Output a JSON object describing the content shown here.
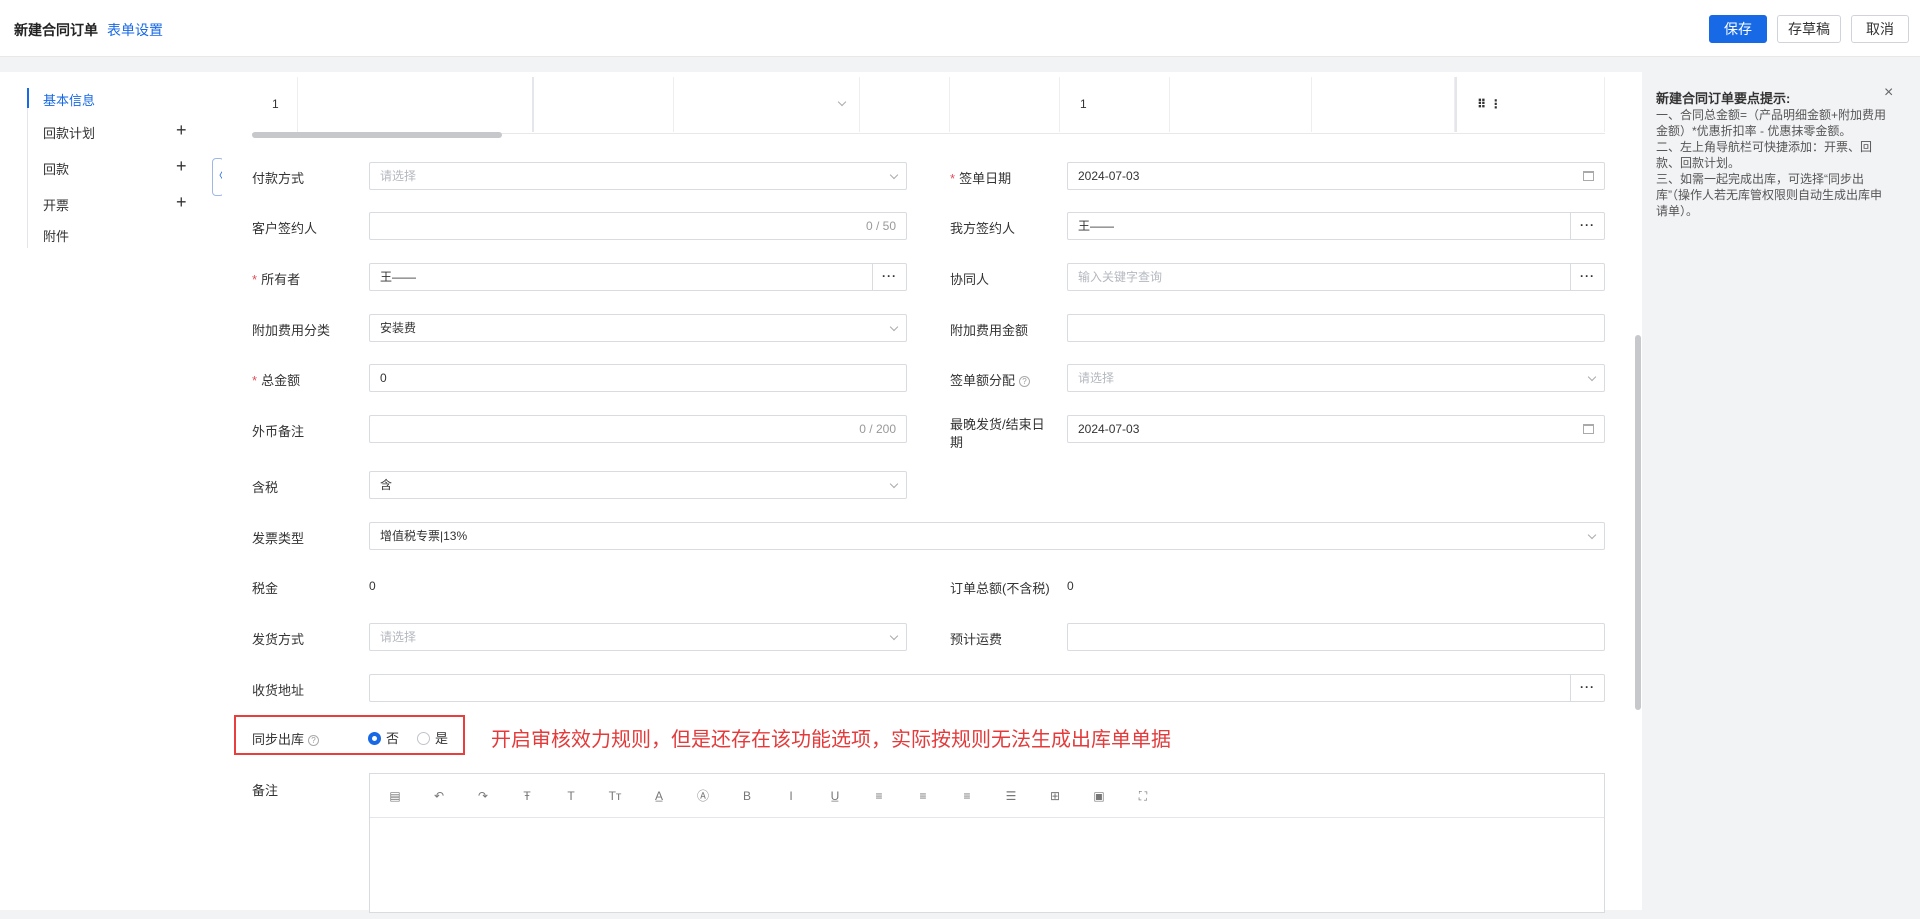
{
  "header": {
    "title": "新建合同订单",
    "settings_link": "表单设置",
    "save": "保存",
    "draft": "存草稿",
    "cancel": "取消"
  },
  "nav": {
    "items": [
      {
        "label": "基本信息"
      },
      {
        "label": "回款计划"
      },
      {
        "label": "回款"
      },
      {
        "label": "开票"
      },
      {
        "label": "附件"
      }
    ],
    "plus": "+",
    "collapse": "〈"
  },
  "table_row": {
    "index": "1",
    "qty": "1",
    "handle": "⠿ ⋮"
  },
  "form": {
    "payment_method": {
      "label": "付款方式",
      "placeholder": "请选择"
    },
    "sign_date": {
      "label": "签单日期",
      "value": "2024-07-03"
    },
    "customer_signer": {
      "label": "客户签约人",
      "count": "0 / 50"
    },
    "our_signer": {
      "label": "我方签约人",
      "value": "王——"
    },
    "owner": {
      "label": "所有者",
      "value": "王——"
    },
    "collaborator": {
      "label": "协同人",
      "placeholder": "输入关键字查询"
    },
    "extra_fee_type": {
      "label": "附加费用分类",
      "value": "安装费"
    },
    "extra_fee_amount": {
      "label": "附加费用金额",
      "value": ""
    },
    "total_amount": {
      "label": "总金额",
      "value": "0"
    },
    "sign_distribution": {
      "label": "签单额分配",
      "placeholder": "请选择"
    },
    "fx_note": {
      "label": "外币备注",
      "count": "0 / 200"
    },
    "latest_ship_date": {
      "label": "最晚发货/结束日期",
      "label_line1": "最晚发货/结束日",
      "label_line2": "期",
      "value": "2024-07-03"
    },
    "tax_included": {
      "label": "含税",
      "value": "含"
    },
    "invoice_type": {
      "label": "发票类型",
      "value": "增值税专票|13%"
    },
    "tax": {
      "label": "税金",
      "value": "0"
    },
    "order_total_ex_tax": {
      "label": "订单总额(不含税)",
      "value": "0"
    },
    "ship_method": {
      "label": "发货方式",
      "placeholder": "请选择"
    },
    "est_freight": {
      "label": "预计运费",
      "value": ""
    },
    "ship_address": {
      "label": "收货地址",
      "value": ""
    },
    "sync_outbound": {
      "label": "同步出库",
      "option_no": "否",
      "option_yes": "是",
      "selected": "否"
    },
    "remarks": {
      "label": "备注"
    }
  },
  "required_mark": "*",
  "more_glyph": "···",
  "help_glyph": "?",
  "annotation": "开启审核效力规则，但是还存在该功能选项，实际按规则无法生成出库单单据",
  "editor_toolbar": [
    {
      "icon": "format-painter-icon",
      "glyph": "▤"
    },
    {
      "icon": "undo-icon",
      "glyph": "↶"
    },
    {
      "icon": "redo-icon",
      "glyph": "↷"
    },
    {
      "icon": "strikethrough-icon",
      "glyph": "Ŧ"
    },
    {
      "icon": "font-size-icon",
      "glyph": "T"
    },
    {
      "icon": "clear-format-icon",
      "glyph": "Tт"
    },
    {
      "icon": "font-color-icon",
      "glyph": "A̲"
    },
    {
      "icon": "background-color-icon",
      "glyph": "Ⓐ"
    },
    {
      "icon": "bold-icon",
      "glyph": "B"
    },
    {
      "icon": "italic-icon",
      "glyph": "I"
    },
    {
      "icon": "underline-icon",
      "glyph": "U̲"
    },
    {
      "icon": "align-left-icon",
      "glyph": "≡"
    },
    {
      "icon": "align-center-icon",
      "glyph": "≡"
    },
    {
      "icon": "align-right-icon",
      "glyph": "≡"
    },
    {
      "icon": "justify-icon",
      "glyph": "☰"
    },
    {
      "icon": "table-icon",
      "glyph": "⊞"
    },
    {
      "icon": "image-icon",
      "glyph": "▣"
    },
    {
      "icon": "fullscreen-icon",
      "glyph": "⛶"
    }
  ],
  "tips": {
    "title": "新建合同订单要点提示:",
    "lines": [
      "一、合同总金额=（产品明细金额+附加费用金额）*优惠折扣率 - 优惠抹零金额。",
      "二、左上角导航栏可快捷添加：开票、回款、回款计划。",
      "三、如需一起完成出库，可选择“同步出库”（操作人若无库管权限则自动生成出库申请单）。"
    ],
    "close": "×"
  },
  "colors": {
    "primary": "#1869e6",
    "required": "#e34d59",
    "annotation": "#e33b3b"
  }
}
